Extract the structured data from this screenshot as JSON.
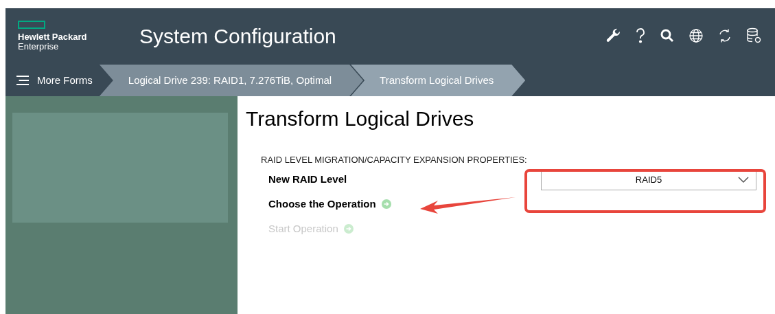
{
  "header": {
    "logo_line_1": "Hewlett Packard",
    "logo_line_2": "Enterprise",
    "title": "System Configuration"
  },
  "breadcrumbs": [
    {
      "label": "More Forms",
      "kind": "menu",
      "selected": false
    },
    {
      "label": "Logical Drive 239: RAID1, 7.276TiB, Optimal",
      "kind": "crumb",
      "selected": false
    },
    {
      "label": "Transform Logical Drives",
      "kind": "crumb",
      "selected": true
    }
  ],
  "page": {
    "title": "Transform Logical Drives",
    "section": "RAID LEVEL MIGRATION/CAPACITY EXPANSION PROPERTIES:",
    "new_raid_level": {
      "label": "New RAID Level",
      "value": "RAID5"
    },
    "operations": [
      {
        "label": "Choose the Operation",
        "disabled": false
      },
      {
        "label": "Start Operation",
        "disabled": true
      }
    ]
  }
}
